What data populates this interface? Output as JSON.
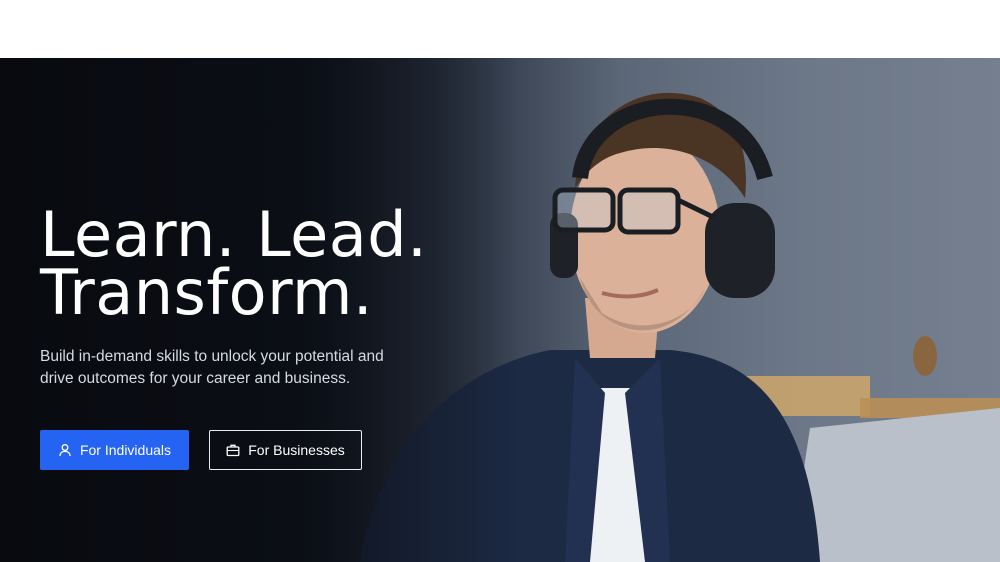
{
  "hero": {
    "headline_line1": "Learn. Lead.",
    "headline_line2": "Transform.",
    "subtext": "Build in-demand skills to unlock your potential and drive outcomes for your career and business.",
    "primary_button": {
      "label": "For Individuals",
      "icon": "user-icon"
    },
    "secondary_button": {
      "label": "For Businesses",
      "icon": "briefcase-icon"
    }
  },
  "colors": {
    "accent": "#2563f2",
    "hero_dark": "#0b0e14",
    "text_light": "#ffffff"
  }
}
